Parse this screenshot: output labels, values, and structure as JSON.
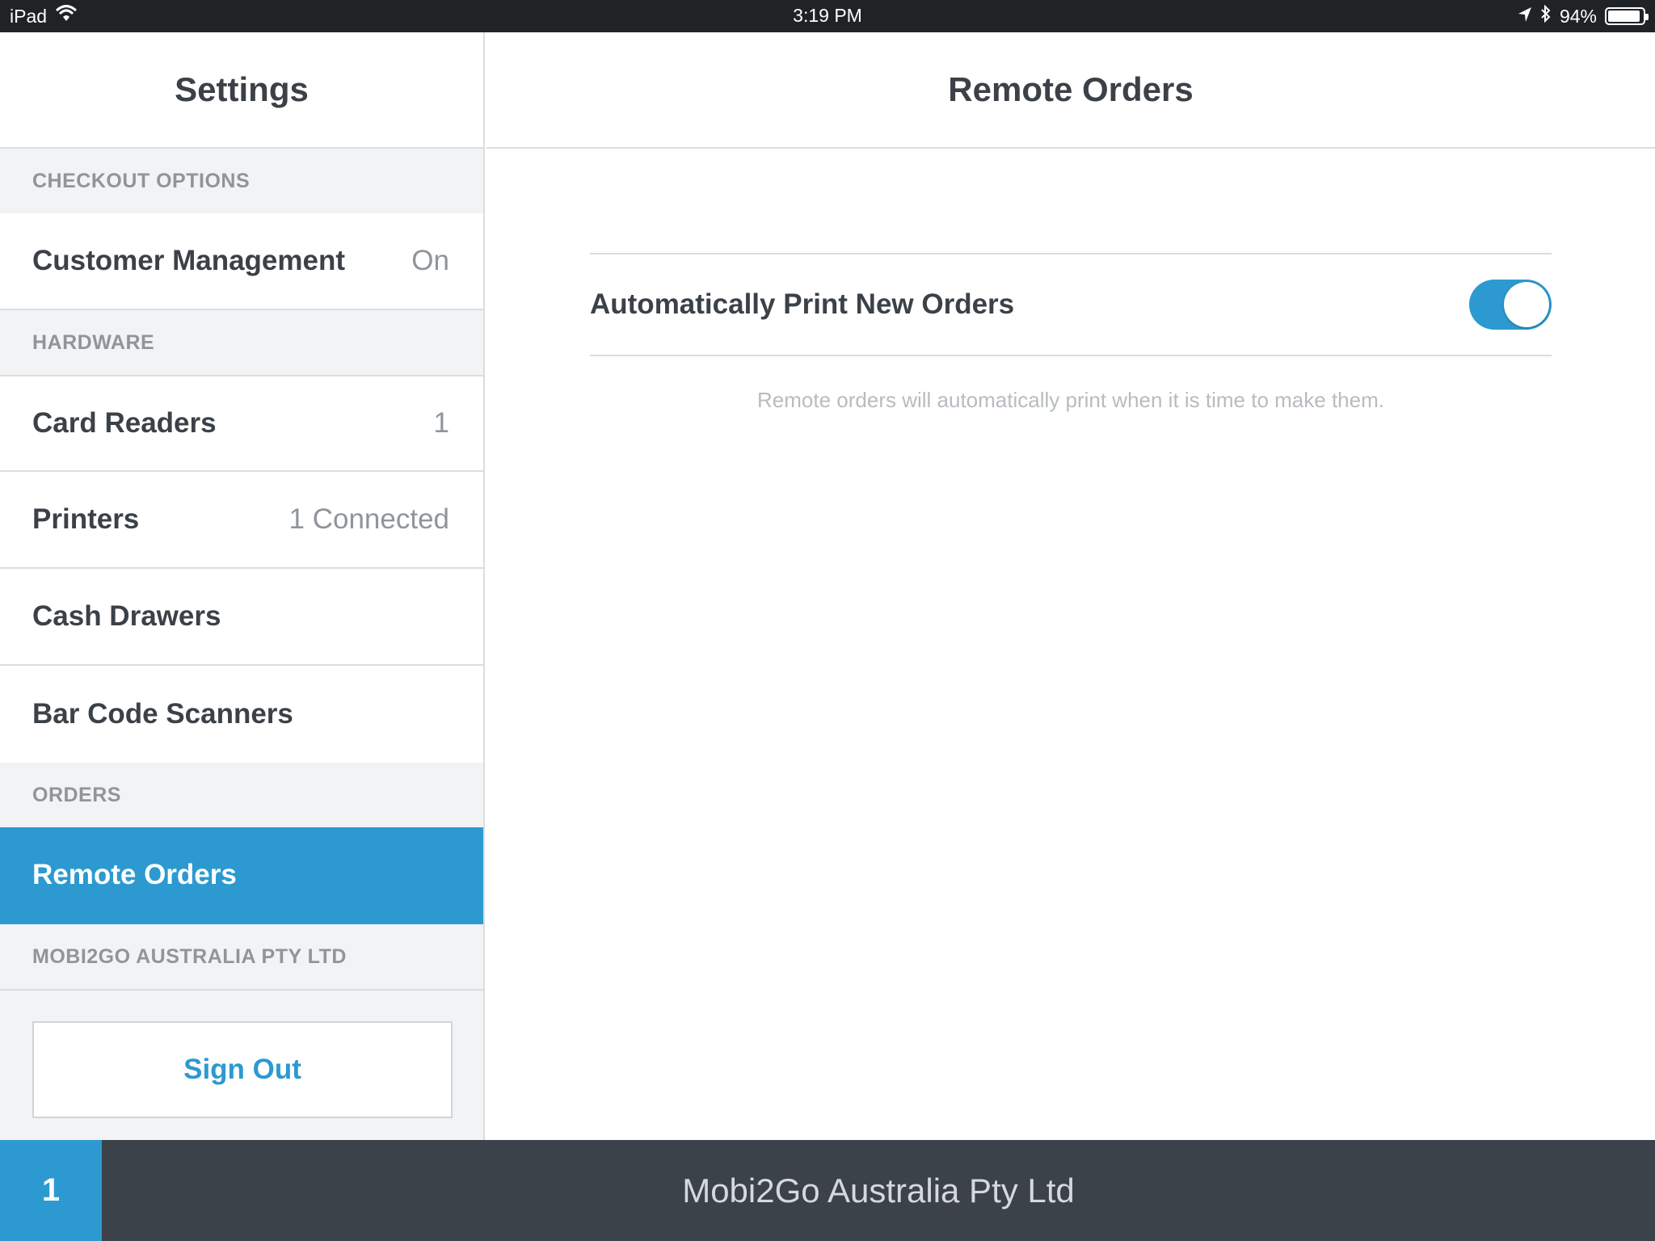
{
  "status_bar": {
    "device": "iPad",
    "time": "3:19 PM",
    "battery": "94%",
    "battery_level": 0.94,
    "icons": [
      "wifi-icon",
      "location-arrow-icon",
      "bluetooth-icon",
      "battery-icon"
    ]
  },
  "sidebar": {
    "title": "Settings",
    "sections": [
      {
        "label": "CHECKOUT OPTIONS",
        "items": [
          {
            "label": "Customer Management",
            "value": "On"
          }
        ]
      },
      {
        "label": "HARDWARE",
        "items": [
          {
            "label": "Card Readers",
            "value": "1"
          },
          {
            "label": "Printers",
            "value": "1 Connected"
          },
          {
            "label": "Cash Drawers",
            "value": ""
          },
          {
            "label": "Bar Code Scanners",
            "value": ""
          }
        ]
      },
      {
        "label": "ORDERS",
        "items": [
          {
            "label": "Remote Orders",
            "value": "",
            "active": true
          }
        ]
      },
      {
        "label": "MOBI2GO AUSTRALIA PTY LTD",
        "items": []
      }
    ],
    "sign_out": "Sign Out"
  },
  "main": {
    "title": "Remote Orders",
    "setting": {
      "label": "Automatically Print New Orders",
      "enabled": true
    },
    "help_text": "Remote orders will automatically print when it is time to make them."
  },
  "footer": {
    "badge": "1",
    "business_name": "Mobi2Go Australia Pty Ltd"
  },
  "colors": {
    "accent": "#2c9ad0",
    "footer_bg": "#3b4249",
    "status_bar_bg": "#1f2326"
  }
}
